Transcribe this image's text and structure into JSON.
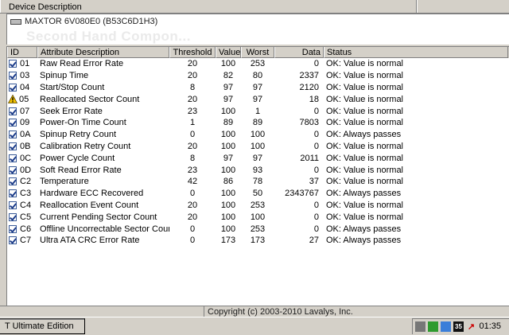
{
  "header": {
    "title": "Device Description"
  },
  "device": {
    "name": "MAXTOR 6V080E0 (B53C6D1H3)",
    "watermark": "Second Hand Compon..."
  },
  "table": {
    "columns": {
      "id": "ID",
      "attribute": "Attribute Description",
      "threshold": "Threshold",
      "value": "Value",
      "worst": "Worst",
      "data": "Data",
      "status": "Status"
    },
    "rows": [
      {
        "icon": "check",
        "id": "01",
        "attr": "Raw Read Error Rate",
        "threshold": "20",
        "value": "100",
        "worst": "253",
        "data": "0",
        "status": "OK: Value is normal"
      },
      {
        "icon": "check",
        "id": "03",
        "attr": "Spinup Time",
        "threshold": "20",
        "value": "82",
        "worst": "80",
        "data": "2337",
        "status": "OK: Value is normal"
      },
      {
        "icon": "check",
        "id": "04",
        "attr": "Start/Stop Count",
        "threshold": "8",
        "value": "97",
        "worst": "97",
        "data": "2120",
        "status": "OK: Value is normal"
      },
      {
        "icon": "warning",
        "id": "05",
        "attr": "Reallocated Sector Count",
        "threshold": "20",
        "value": "97",
        "worst": "97",
        "data": "18",
        "status": "OK: Value is normal"
      },
      {
        "icon": "check",
        "id": "07",
        "attr": "Seek Error Rate",
        "threshold": "23",
        "value": "100",
        "worst": "1",
        "data": "0",
        "status": "OK: Value is normal"
      },
      {
        "icon": "check",
        "id": "09",
        "attr": "Power-On Time Count",
        "threshold": "1",
        "value": "89",
        "worst": "89",
        "data": "7803",
        "status": "OK: Value is normal"
      },
      {
        "icon": "check",
        "id": "0A",
        "attr": "Spinup Retry Count",
        "threshold": "0",
        "value": "100",
        "worst": "100",
        "data": "0",
        "status": "OK: Always passes"
      },
      {
        "icon": "check",
        "id": "0B",
        "attr": "Calibration Retry Count",
        "threshold": "20",
        "value": "100",
        "worst": "100",
        "data": "0",
        "status": "OK: Value is normal"
      },
      {
        "icon": "check",
        "id": "0C",
        "attr": "Power Cycle Count",
        "threshold": "8",
        "value": "97",
        "worst": "97",
        "data": "2011",
        "status": "OK: Value is normal"
      },
      {
        "icon": "check",
        "id": "0D",
        "attr": "Soft Read Error Rate",
        "threshold": "23",
        "value": "100",
        "worst": "93",
        "data": "0",
        "status": "OK: Value is normal"
      },
      {
        "icon": "check",
        "id": "C2",
        "attr": "Temperature",
        "threshold": "42",
        "value": "86",
        "worst": "78",
        "data": "37",
        "status": "OK: Value is normal"
      },
      {
        "icon": "check",
        "id": "C3",
        "attr": "Hardware ECC Recovered",
        "threshold": "0",
        "value": "100",
        "worst": "50",
        "data": "2343767",
        "status": "OK: Always passes"
      },
      {
        "icon": "check",
        "id": "C4",
        "attr": "Reallocation Event Count",
        "threshold": "20",
        "value": "100",
        "worst": "253",
        "data": "0",
        "status": "OK: Value is normal"
      },
      {
        "icon": "check",
        "id": "C5",
        "attr": "Current Pending Sector Count",
        "threshold": "20",
        "value": "100",
        "worst": "100",
        "data": "0",
        "status": "OK: Value is normal"
      },
      {
        "icon": "check",
        "id": "C6",
        "attr": "Offline Uncorrectable Sector Count",
        "threshold": "0",
        "value": "100",
        "worst": "253",
        "data": "0",
        "status": "OK: Always passes"
      },
      {
        "icon": "check",
        "id": "C7",
        "attr": "Ultra ATA CRC Error Rate",
        "threshold": "0",
        "value": "173",
        "worst": "173",
        "data": "27",
        "status": "OK: Always passes"
      }
    ]
  },
  "statusbar": {
    "copyright": "Copyright (c) 2003-2010 Lavalys, Inc."
  },
  "taskbar": {
    "button": "T Ultimate Edition",
    "tray_badge": "35",
    "clock": "01:35"
  },
  "colors": {
    "background": "#d4d0c8",
    "check": "#1d3d8a",
    "warning": "#f2c200"
  }
}
